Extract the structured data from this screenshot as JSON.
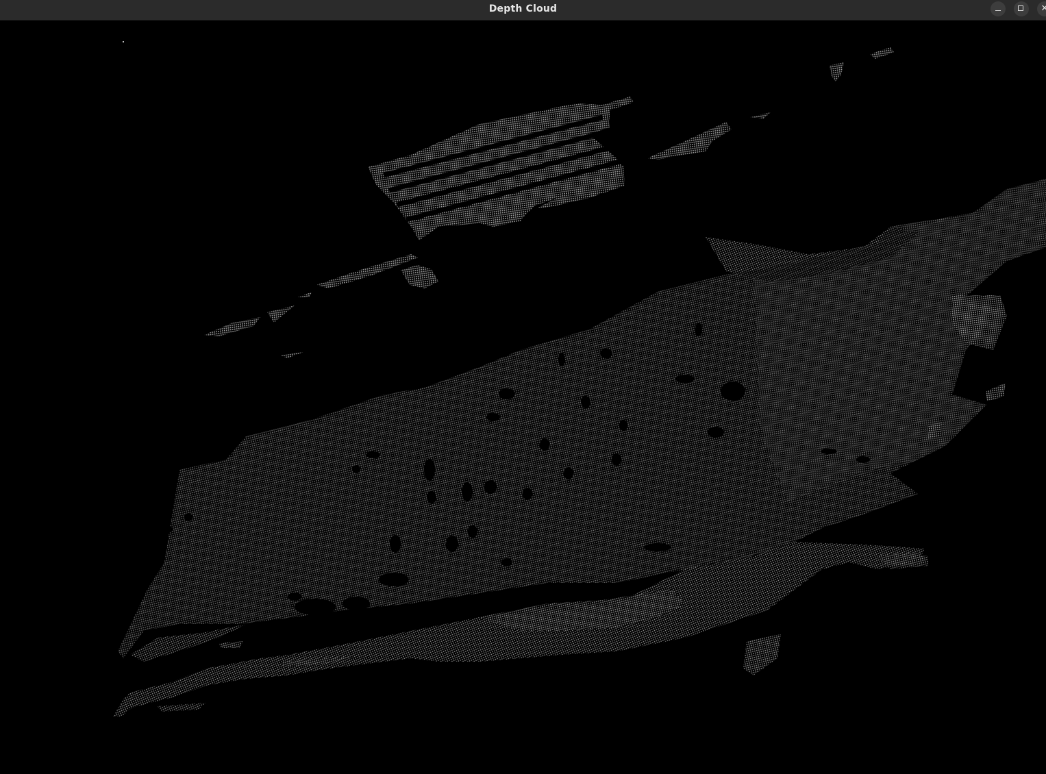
{
  "window": {
    "title": "Depth Cloud",
    "controls": {
      "minimize": "minimize",
      "maximize": "maximize",
      "close": "close"
    }
  },
  "viewport": {
    "background": "#000000",
    "point_color": "#8c8c8c"
  }
}
